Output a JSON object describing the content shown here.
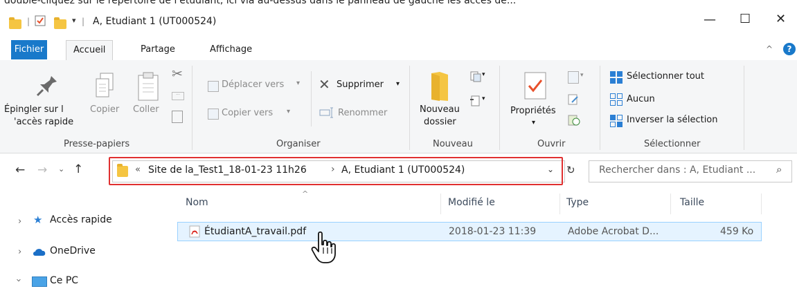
{
  "caption_fragment": "double-cliquez sur le répertoire de l'étudiant, ici via au-dessus dans le panneau de gauche les accès de...",
  "window": {
    "title": "A, Etudiant 1 (UT000524)",
    "minimize": "—",
    "maximize": "☐",
    "close": "✕"
  },
  "tabs": {
    "file": "Fichier",
    "home": "Accueil",
    "share": "Partage",
    "view": "Affichage"
  },
  "ribbon": {
    "pin_label_1": "Épingler sur l",
    "pin_label_2": "'accès rapide",
    "copy": "Copier",
    "paste": "Coller",
    "move_to": "Déplacer vers",
    "copy_to": "Copier vers",
    "delete": "Supprimer",
    "rename": "Renommer",
    "new_folder_1": "Nouveau",
    "new_folder_2": "dossier",
    "properties": "Propriétés",
    "select_all": "Sélectionner tout",
    "select_none": "Aucun",
    "invert_selection": "Inverser la sélection",
    "groups": {
      "clipboard": "Presse-papiers",
      "organize": "Organiser",
      "new": "Nouveau",
      "open": "Ouvrir",
      "select": "Sélectionner"
    }
  },
  "address": {
    "overflow": "«",
    "crumb1": "Site de la_Test1_18-01-23 11h26",
    "sep": "›",
    "crumb2": "A, Etudiant 1 (UT000524)"
  },
  "search": {
    "placeholder": "Rechercher dans : A, Etudiant ..."
  },
  "columns": {
    "name": "Nom",
    "modified": "Modifié le",
    "type": "Type",
    "size": "Taille"
  },
  "files": [
    {
      "name": "ÉtudiantA_travail.pdf",
      "modified": "2018-01-23 11:39",
      "type": "Adobe Acrobat D...",
      "size": "459 Ko"
    }
  ],
  "sidebar": {
    "items": [
      {
        "label": "Accès rapide"
      },
      {
        "label": "OneDrive"
      },
      {
        "label": "Ce PC"
      }
    ]
  },
  "colors": {
    "file_tab": "#1979ca",
    "highlight": "#e03030",
    "selection": "#e5f3ff"
  }
}
